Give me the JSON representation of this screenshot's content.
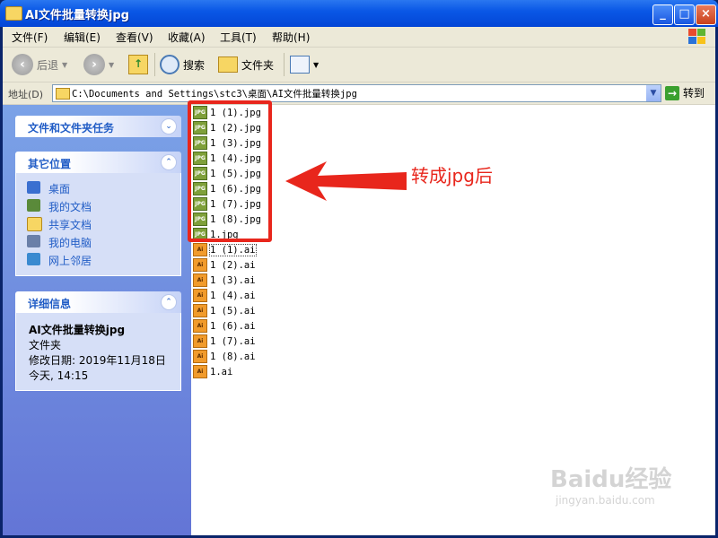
{
  "window": {
    "title": "AI文件批量转换jpg",
    "controls": {
      "minimize": "_",
      "maximize": "□",
      "close": "×"
    }
  },
  "menubar": {
    "items": [
      "文件(F)",
      "编辑(E)",
      "查看(V)",
      "收藏(A)",
      "工具(T)",
      "帮助(H)"
    ]
  },
  "toolbar": {
    "back_label": "后退",
    "search_label": "搜索",
    "folders_label": "文件夹"
  },
  "address": {
    "label": "地址(D)",
    "value": "C:\\Documents and Settings\\stc3\\桌面\\AI文件批量转换jpg",
    "go_label": "转到"
  },
  "taskpane": {
    "tasks_title": "文件和文件夹任务",
    "places_title": "其它位置",
    "places": [
      {
        "label": "桌面",
        "icon": "desktop-icon",
        "color": "#3a6fd0"
      },
      {
        "label": "我的文档",
        "icon": "my-documents-icon",
        "color": "#5a8a3a"
      },
      {
        "label": "共享文档",
        "icon": "folder-icon",
        "color": "#f7d663"
      },
      {
        "label": "我的电脑",
        "icon": "computer-icon",
        "color": "#6a7fa8"
      },
      {
        "label": "网上邻居",
        "icon": "network-icon",
        "color": "#3a8ad0"
      }
    ],
    "details_title": "详细信息",
    "details": {
      "name": "AI文件批量转换jpg",
      "type": "文件夹",
      "modified": "修改日期: 2019年11月18日",
      "time": "今天, 14:15"
    }
  },
  "files": {
    "jpg": [
      "1 (1).jpg",
      "1 (2).jpg",
      "1 (3).jpg",
      "1 (4).jpg",
      "1 (5).jpg",
      "1 (6).jpg",
      "1 (7).jpg",
      "1 (8).jpg",
      "1.jpg"
    ],
    "ai": [
      "1 (1).ai",
      "1 (2).ai",
      "1 (3).ai",
      "1 (4).ai",
      "1 (5).ai",
      "1 (6).ai",
      "1 (7).ai",
      "1 (8).ai",
      "1.ai"
    ],
    "jpg_icon_text": "JPG",
    "ai_icon_text": "Ai"
  },
  "annotation": {
    "text": "转成jpg后",
    "color": "#e8261c"
  },
  "watermark": {
    "main": "Baidu经验",
    "sub": "jingyan.baidu.com"
  }
}
